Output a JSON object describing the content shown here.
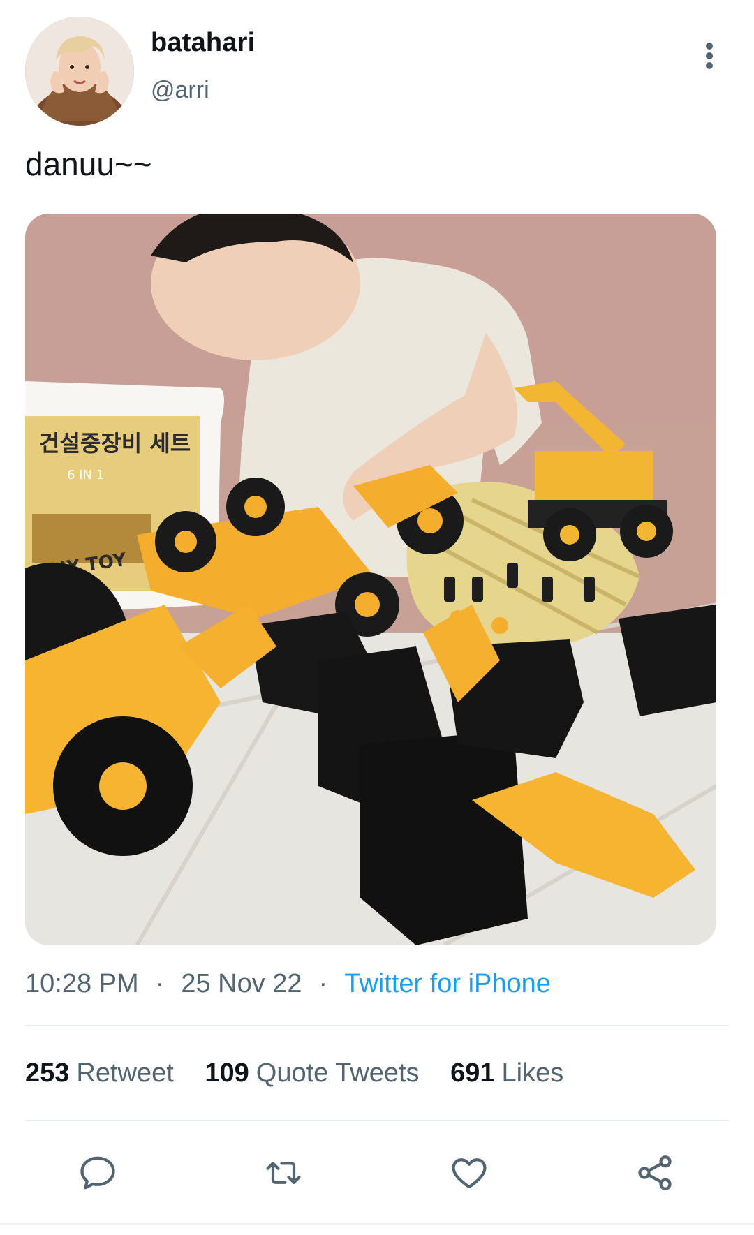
{
  "tweet": {
    "author": {
      "display_name": "batahari",
      "handle": "@arri",
      "avatar_icon": "profile-photo"
    },
    "text": "danuu~~",
    "media": {
      "box_text": "건설중장비 세트",
      "box_sub": "6 IN 1",
      "box_diy": "DIY TOY"
    },
    "time": "10:28 PM",
    "date": "25 Nov 22",
    "separator": "·",
    "source": "Twitter for iPhone",
    "stats": {
      "retweets": {
        "count": "253",
        "label": "Retweet"
      },
      "quotes": {
        "count": "109",
        "label": "Quote Tweets"
      },
      "likes": {
        "count": "691",
        "label": "Likes"
      }
    },
    "actions": {
      "reply": "reply-icon",
      "retweet": "retweet-icon",
      "like": "heart-icon",
      "share": "share-icon",
      "more": "more-vertical-icon"
    }
  },
  "colors": {
    "text_primary": "#0f1419",
    "text_secondary": "#536471",
    "link": "#1d9bf0",
    "divider": "#e6ecf0"
  }
}
